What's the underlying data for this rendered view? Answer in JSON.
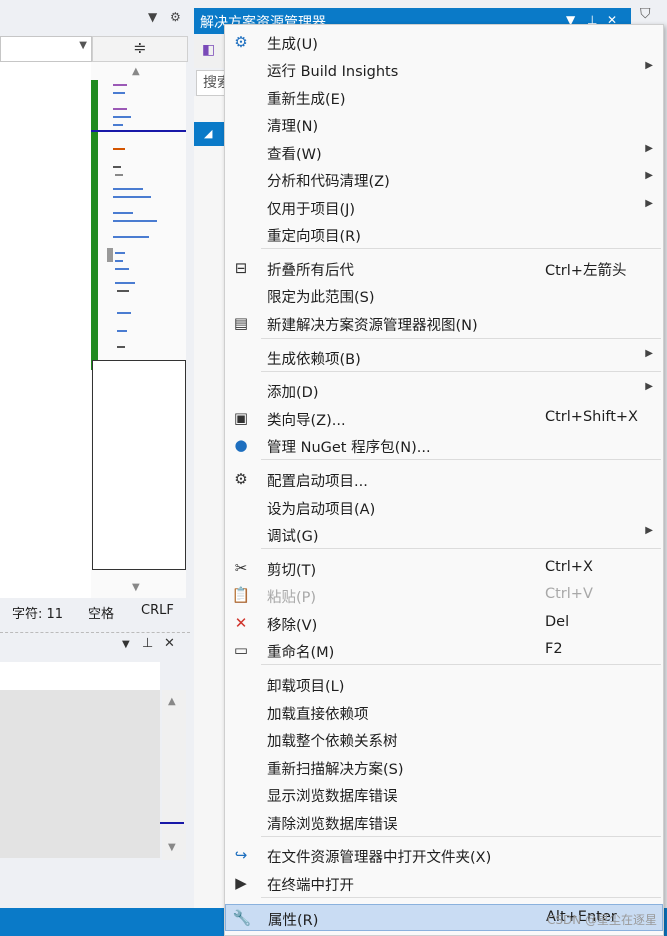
{
  "ide": {
    "status": {
      "char_label": "字符: 11",
      "space_label": "空格",
      "eol_label": "CRLF"
    },
    "split_glyph": "≑"
  },
  "solution_explorer": {
    "title": "解决方案资源管理器",
    "search_placeholder": "搜索"
  },
  "menu": {
    "items": [
      {
        "icon": "build-icon",
        "glyph": "⚙",
        "label": "生成(U)",
        "shortcut": "",
        "submenu": false,
        "disabled": false
      },
      {
        "icon": "",
        "glyph": "",
        "label": "运行 Build Insights",
        "shortcut": "",
        "submenu": true,
        "disabled": false
      },
      {
        "icon": "",
        "glyph": "",
        "label": "重新生成(E)",
        "shortcut": "",
        "submenu": false,
        "disabled": false
      },
      {
        "icon": "",
        "glyph": "",
        "label": "清理(N)",
        "shortcut": "",
        "submenu": false,
        "disabled": false
      },
      {
        "icon": "",
        "glyph": "",
        "label": "查看(W)",
        "shortcut": "",
        "submenu": true,
        "disabled": false
      },
      {
        "icon": "",
        "glyph": "",
        "label": "分析和代码清理(Z)",
        "shortcut": "",
        "submenu": true,
        "disabled": false
      },
      {
        "icon": "",
        "glyph": "",
        "label": "仅用于项目(J)",
        "shortcut": "",
        "submenu": true,
        "disabled": false
      },
      {
        "icon": "",
        "glyph": "",
        "label": "重定向项目(R)",
        "shortcut": "",
        "submenu": false,
        "disabled": false
      },
      {
        "icon": "collapse-icon",
        "glyph": "⊟",
        "label": "折叠所有后代",
        "shortcut": "Ctrl+左箭头",
        "submenu": false,
        "disabled": false
      },
      {
        "icon": "",
        "glyph": "",
        "label": "限定为此范围(S)",
        "shortcut": "",
        "submenu": false,
        "disabled": false
      },
      {
        "icon": "new-view-icon",
        "glyph": "▤",
        "label": "新建解决方案资源管理器视图(N)",
        "shortcut": "",
        "submenu": false,
        "disabled": false
      },
      {
        "icon": "",
        "glyph": "",
        "label": "生成依赖项(B)",
        "shortcut": "",
        "submenu": true,
        "disabled": false
      },
      {
        "icon": "",
        "glyph": "",
        "label": "添加(D)",
        "shortcut": "",
        "submenu": true,
        "disabled": false
      },
      {
        "icon": "class-wizard-icon",
        "glyph": "▣",
        "label": "类向导(Z)...",
        "shortcut": "Ctrl+Shift+X",
        "submenu": false,
        "disabled": false
      },
      {
        "icon": "nuget-icon",
        "glyph": "●",
        "label": "管理 NuGet 程序包(N)...",
        "shortcut": "",
        "submenu": false,
        "disabled": false
      },
      {
        "icon": "gear-icon",
        "glyph": "⚙",
        "label": "配置启动项目...",
        "shortcut": "",
        "submenu": false,
        "disabled": false
      },
      {
        "icon": "",
        "glyph": "",
        "label": "设为启动项目(A)",
        "shortcut": "",
        "submenu": false,
        "disabled": false
      },
      {
        "icon": "",
        "glyph": "",
        "label": "调试(G)",
        "shortcut": "",
        "submenu": true,
        "disabled": false
      },
      {
        "icon": "scissors-icon",
        "glyph": "✂",
        "label": "剪切(T)",
        "shortcut": "Ctrl+X",
        "submenu": false,
        "disabled": false
      },
      {
        "icon": "paste-icon",
        "glyph": "📋",
        "label": "粘贴(P)",
        "shortcut": "Ctrl+V",
        "submenu": false,
        "disabled": true
      },
      {
        "icon": "remove-icon",
        "glyph": "✕",
        "label": "移除(V)",
        "shortcut": "Del",
        "submenu": false,
        "disabled": false
      },
      {
        "icon": "rename-icon",
        "glyph": "▭",
        "label": "重命名(M)",
        "shortcut": "F2",
        "submenu": false,
        "disabled": false
      },
      {
        "icon": "",
        "glyph": "",
        "label": "卸载项目(L)",
        "shortcut": "",
        "submenu": false,
        "disabled": false
      },
      {
        "icon": "",
        "glyph": "",
        "label": "加载直接依赖项",
        "shortcut": "",
        "submenu": false,
        "disabled": false
      },
      {
        "icon": "",
        "glyph": "",
        "label": "加载整个依赖关系树",
        "shortcut": "",
        "submenu": false,
        "disabled": false
      },
      {
        "icon": "",
        "glyph": "",
        "label": "重新扫描解决方案(S)",
        "shortcut": "",
        "submenu": false,
        "disabled": false
      },
      {
        "icon": "",
        "glyph": "",
        "label": "显示浏览数据库错误",
        "shortcut": "",
        "submenu": false,
        "disabled": false
      },
      {
        "icon": "",
        "glyph": "",
        "label": "清除浏览数据库错误",
        "shortcut": "",
        "submenu": false,
        "disabled": false
      },
      {
        "icon": "open-folder-icon",
        "glyph": "↪",
        "label": "在文件资源管理器中打开文件夹(X)",
        "shortcut": "",
        "submenu": false,
        "disabled": false
      },
      {
        "icon": "terminal-icon",
        "glyph": "▶",
        "label": "在终端中打开",
        "shortcut": "",
        "submenu": false,
        "disabled": false
      },
      {
        "icon": "wrench-icon",
        "glyph": "🔧",
        "label": "属性(R)",
        "shortcut": "Alt+Enter",
        "submenu": false,
        "disabled": false,
        "highlighted": true
      }
    ]
  },
  "watermark": "CSDN @星尘在逐星"
}
